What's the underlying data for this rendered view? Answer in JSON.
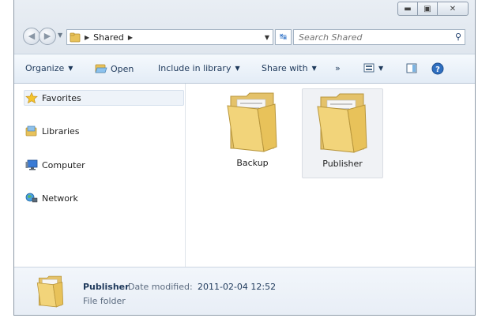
{
  "window": {
    "caption_buttons": [
      "minimize",
      "maximize",
      "close"
    ]
  },
  "navigation": {
    "breadcrumb": [
      "Shared"
    ],
    "search_placeholder": "Search Shared"
  },
  "toolbar": {
    "organize": "Organize",
    "open": "Open",
    "include_in_library": "Include in library",
    "share_with": "Share with",
    "more": "»"
  },
  "sidebar": {
    "items": [
      {
        "label": "Favorites",
        "icon": "star-icon"
      },
      {
        "label": "Libraries",
        "icon": "libraries-icon"
      },
      {
        "label": "Computer",
        "icon": "computer-icon"
      },
      {
        "label": "Network",
        "icon": "network-icon"
      }
    ]
  },
  "files": [
    {
      "name": "Backup",
      "selected": false
    },
    {
      "name": "Publisher",
      "selected": true
    }
  ],
  "details": {
    "name": "Publisher",
    "modified_label": "Date modified:",
    "modified_value": "2011-02-04 12:52",
    "type": "File folder"
  },
  "colors": {
    "toolbar_text": "#1e395b",
    "folder": "#f2d47a",
    "accent": "#2e72c8"
  }
}
